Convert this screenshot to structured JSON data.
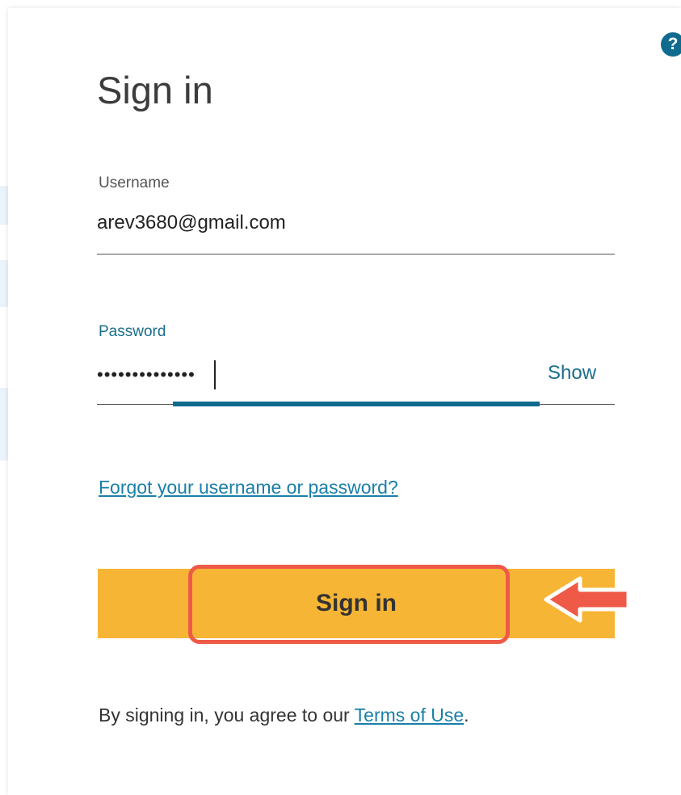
{
  "help": {
    "icon": "help-icon",
    "label": "?"
  },
  "title": "Sign in",
  "username": {
    "label": "Username",
    "value": "arev3680@gmail.com"
  },
  "password": {
    "label": "Password",
    "masked_value": "••••••••••••••",
    "show_label": "Show"
  },
  "forgot_link": "Forgot your username or password?",
  "signin_button": "Sign in",
  "terms": {
    "prefix": "By signing in, you agree to our ",
    "link": "Terms of Use",
    "suffix": "."
  },
  "colors": {
    "accent": "#0e6b8e",
    "link": "#1a7fa8",
    "button": "#f7b535",
    "annotation": "#ee5a47"
  }
}
